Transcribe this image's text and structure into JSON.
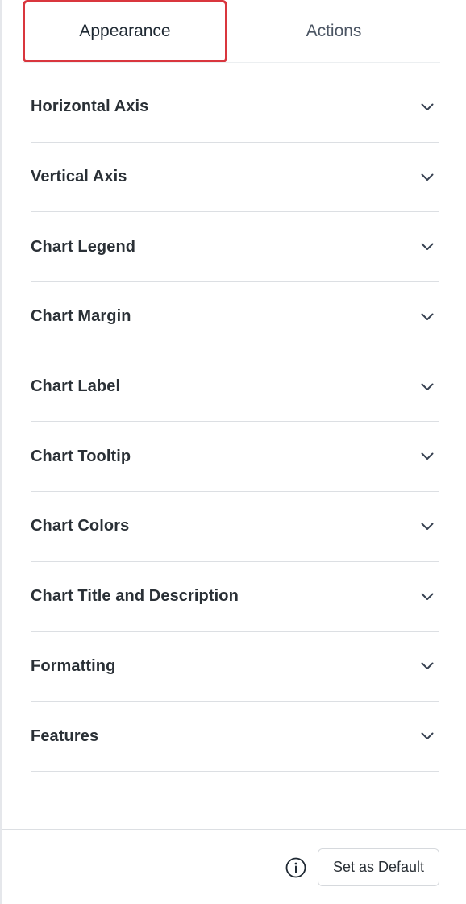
{
  "tabs": {
    "appearance": "Appearance",
    "actions": "Actions",
    "active": "Appearance",
    "highlight_color": "#d9363e"
  },
  "sections": [
    {
      "label": "Horizontal Axis",
      "icon": "chevron-down-icon"
    },
    {
      "label": "Vertical Axis",
      "icon": "chevron-down-icon"
    },
    {
      "label": "Chart Legend",
      "icon": "chevron-down-icon"
    },
    {
      "label": "Chart Margin",
      "icon": "chevron-down-icon"
    },
    {
      "label": "Chart Label",
      "icon": "chevron-down-icon"
    },
    {
      "label": "Chart Tooltip",
      "icon": "chevron-down-icon"
    },
    {
      "label": "Chart Colors",
      "icon": "chevron-down-icon"
    },
    {
      "label": "Chart Title and Description",
      "icon": "chevron-down-icon"
    },
    {
      "label": "Formatting",
      "icon": "chevron-down-icon"
    },
    {
      "label": "Features",
      "icon": "chevron-down-icon"
    }
  ],
  "footer": {
    "info_icon": "info-icon",
    "set_default_label": "Set as Default"
  }
}
